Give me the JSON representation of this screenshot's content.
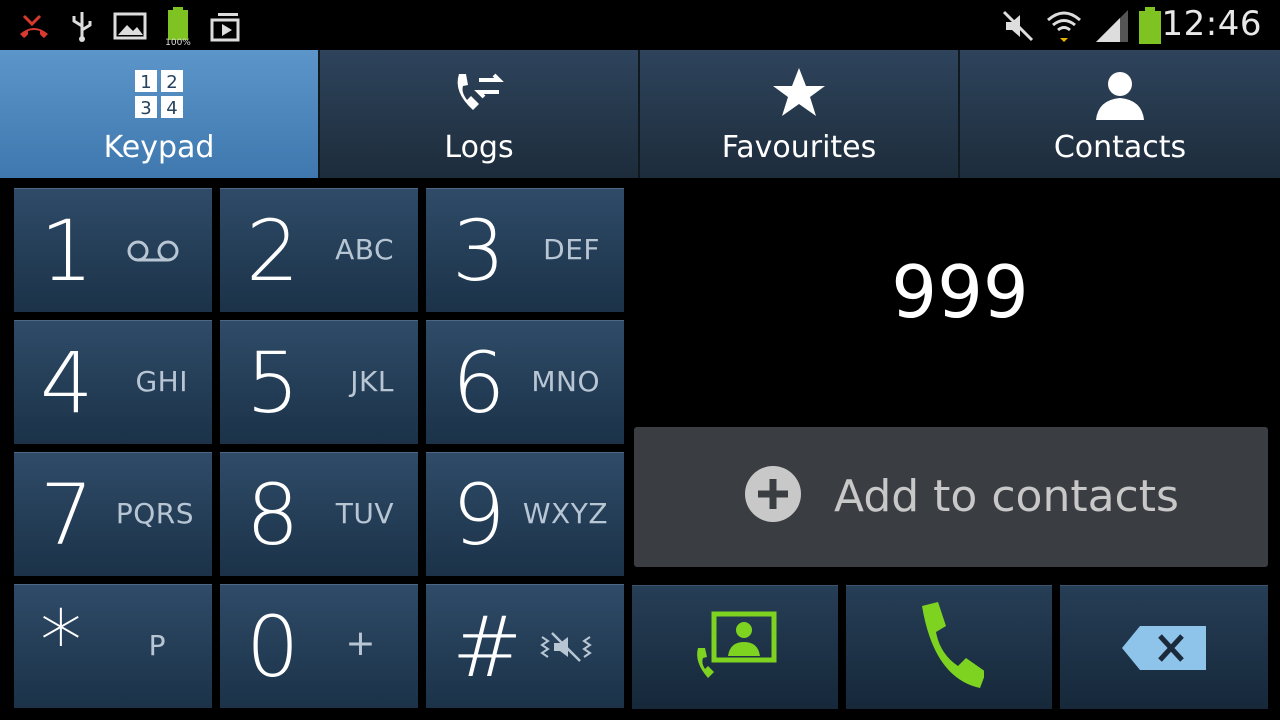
{
  "status_bar": {
    "time": "12:46",
    "battery_label": "100%",
    "icons": [
      "missed-call-icon",
      "usb-icon",
      "image-icon",
      "battery-icon",
      "media-icon",
      "mute-icon",
      "wifi-icon",
      "signal-icon",
      "battery-icon"
    ]
  },
  "tabs": [
    {
      "label": "Keypad",
      "icon": "keypad-icon",
      "active": true
    },
    {
      "label": "Logs",
      "icon": "logs-icon",
      "active": false
    },
    {
      "label": "Favourites",
      "icon": "star-icon",
      "active": false
    },
    {
      "label": "Contacts",
      "icon": "contact-icon",
      "active": false
    }
  ],
  "keypad": {
    "keys": [
      {
        "digit": "1",
        "letters": "",
        "icon": "voicemail-icon"
      },
      {
        "digit": "2",
        "letters": "ABC"
      },
      {
        "digit": "3",
        "letters": "DEF"
      },
      {
        "digit": "4",
        "letters": "GHI"
      },
      {
        "digit": "5",
        "letters": "JKL"
      },
      {
        "digit": "6",
        "letters": "MNO"
      },
      {
        "digit": "7",
        "letters": "PQRS"
      },
      {
        "digit": "8",
        "letters": "TUV"
      },
      {
        "digit": "9",
        "letters": "WXYZ"
      },
      {
        "digit": "*",
        "letters": "P"
      },
      {
        "digit": "0",
        "letters": "+"
      },
      {
        "digit": "#",
        "letters": "",
        "icon": "vibrate-mute-icon"
      }
    ]
  },
  "dialer": {
    "number": "999",
    "add_to_contacts": "Add to contacts"
  },
  "actions": [
    "contact-card-icon",
    "call-icon",
    "backspace-icon"
  ],
  "colors": {
    "accent_green": "#7ed321",
    "tab_active": "#4a86bd",
    "key_bg": "#243d56"
  }
}
